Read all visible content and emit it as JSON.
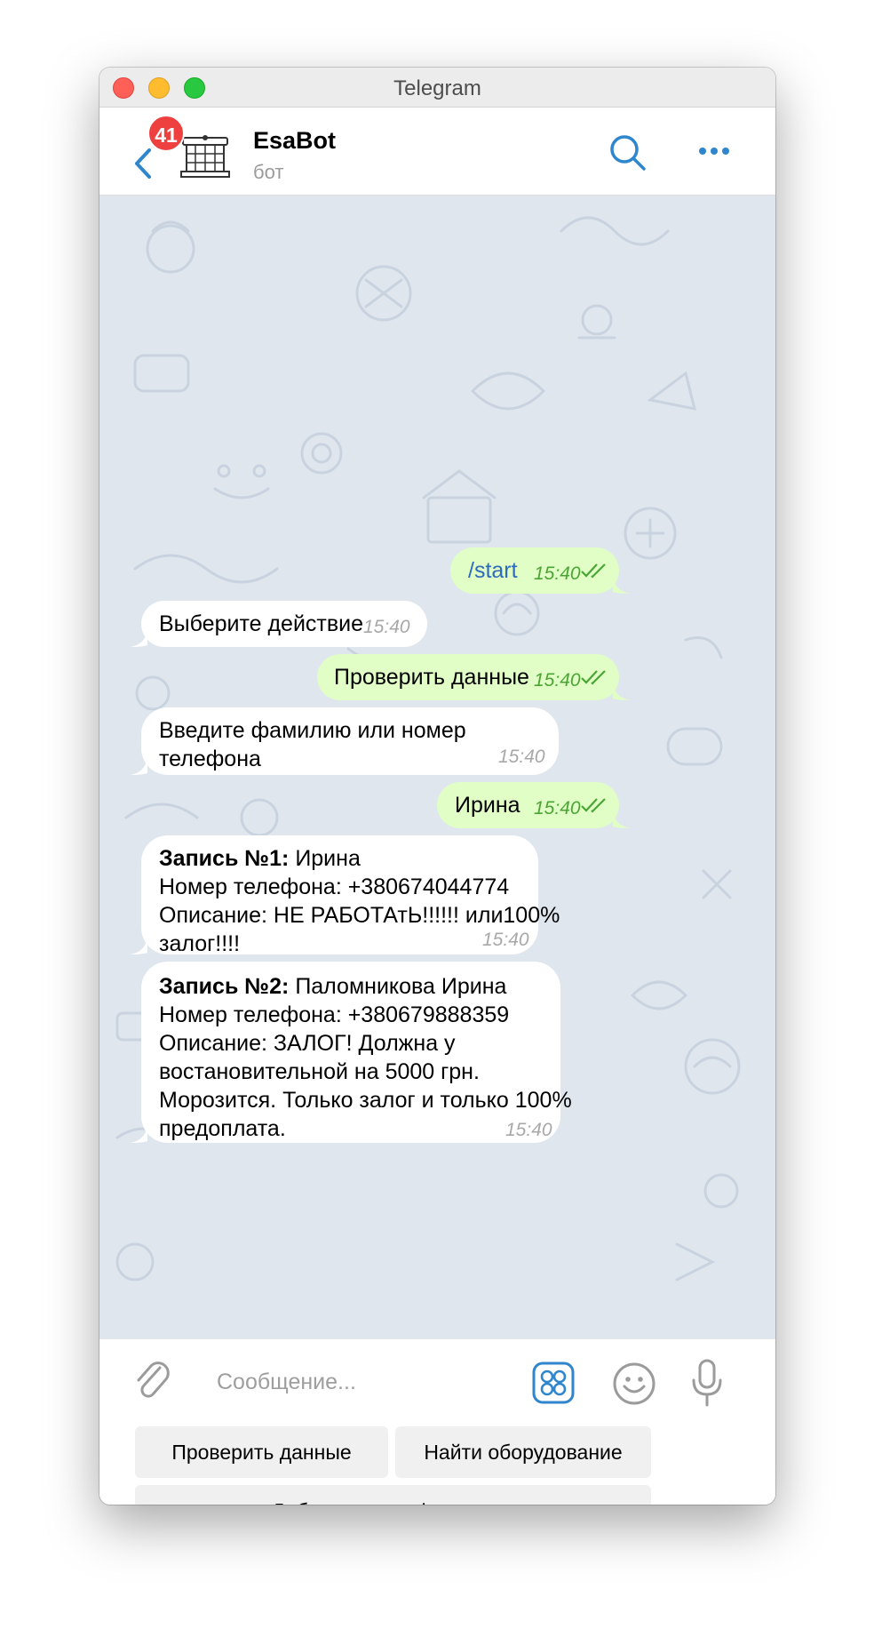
{
  "window": {
    "title": "Telegram"
  },
  "header": {
    "unread_count": "41",
    "chat_name": "EsaBot",
    "chat_status": "бот"
  },
  "messages": [
    {
      "direction": "out",
      "text": "/start",
      "time": "15:40",
      "read": true,
      "text_color": "#2e6bbd"
    },
    {
      "direction": "in",
      "text": "Выберите действие",
      "time": "15:40"
    },
    {
      "direction": "out",
      "text": "Проверить данные",
      "time": "15:40",
      "read": true
    },
    {
      "direction": "in",
      "text": "Введите фамилию или номер телефона",
      "time": "15:40"
    },
    {
      "direction": "out",
      "text": "Ирина",
      "time": "15:40",
      "read": true
    },
    {
      "direction": "in",
      "title": "Запись №1:",
      "title_value": "Ирина",
      "lines": [
        "Номер телефона: +380674044774",
        "Описание: НЕ РАБОТАтЬ!!!!!! или100%",
        "залог!!!!"
      ],
      "time": "15:40"
    },
    {
      "direction": "in",
      "title": "Запись №2:",
      "title_value": "Паломникова Ирина",
      "lines": [
        "Номер телефона: +380679888359",
        "Описание: ЗАЛОГ! Должна у",
        "востановительной на 5000 грн.",
        "Морозится. Только залог и только 100%",
        "предоплата."
      ],
      "time": "15:40"
    }
  ],
  "composer": {
    "placeholder": "Сообщение...",
    "value": ""
  },
  "keyboard": {
    "buttons": [
      "Проверить данные",
      "Найти оборудование",
      "Добавление информации"
    ]
  },
  "icons": {
    "back": "chevron-left-icon",
    "search": "search-icon",
    "more": "more-dots-icon",
    "attach": "paperclip-icon",
    "bot_keyboard": "bot-keyboard-icon",
    "emoji": "emoji-icon",
    "microphone": "microphone-icon"
  },
  "colors": {
    "accent": "#2f86cd",
    "badge": "#ef4040",
    "outgoing_bubble": "#e1fec6",
    "incoming_bubble": "#ffffff",
    "chat_background": "#dfe6ee",
    "read_ticks": "#4ba534"
  }
}
